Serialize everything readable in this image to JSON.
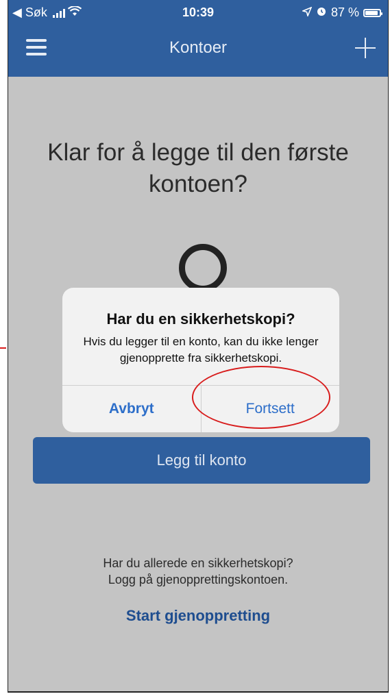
{
  "status_bar": {
    "back_label": "◀ Søk",
    "time": "10:39",
    "battery": "87 %"
  },
  "nav": {
    "title": "Kontoer"
  },
  "main": {
    "headline": "Klar for å legge til den første kontoen?",
    "add_account_button": "Legg til konto",
    "restore_prompt_line1": "Har du allerede en sikkerhetskopi?",
    "restore_prompt_line2": "Logg på gjenopprettingskontoen.",
    "restore_link": "Start gjenoppretting"
  },
  "dialog": {
    "title": "Har du en sikkerhetskopi?",
    "message": "Hvis du legger til en konto, kan du ikke lenger gjenopprette fra sikkerhetskopi.",
    "cancel_label": "Avbryt",
    "continue_label": "Fortsett"
  },
  "colors": {
    "brand_blue": "#2f5f9e",
    "dialog_button_blue": "#2d6ec9",
    "annotation_red": "#d81c1c"
  }
}
